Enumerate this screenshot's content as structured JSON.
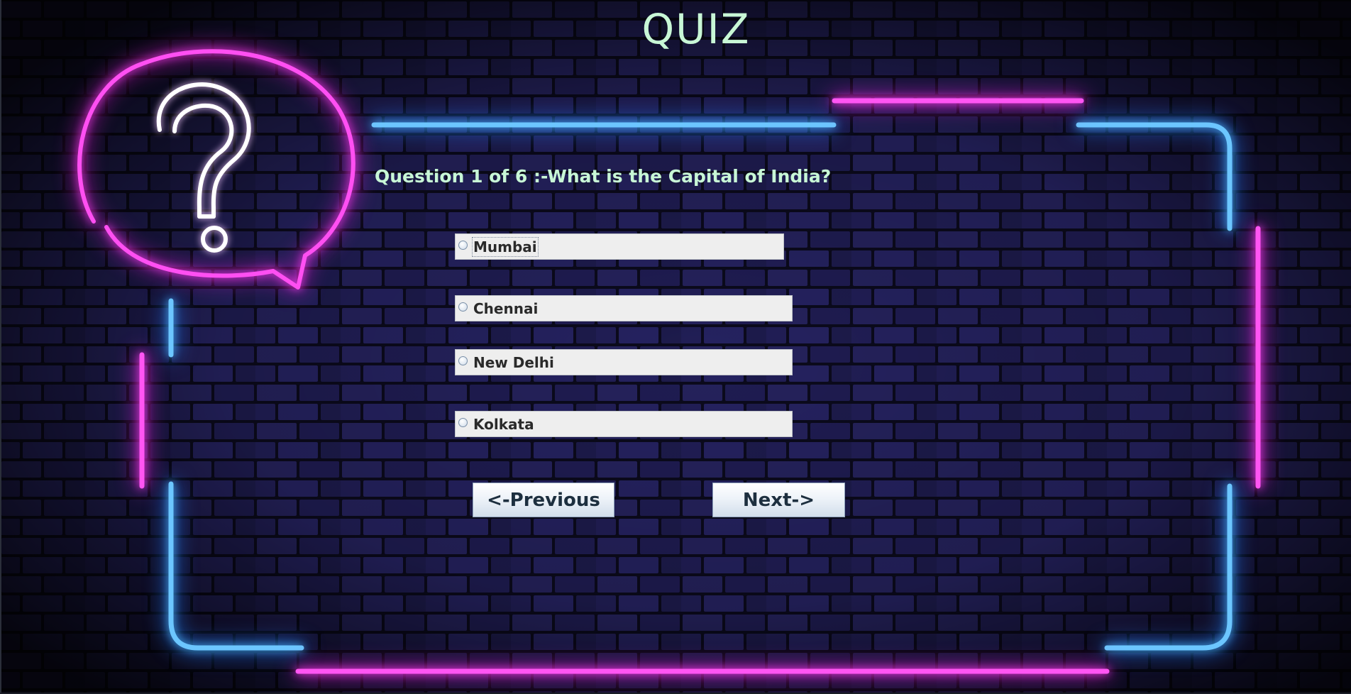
{
  "app": {
    "title": "QUIZ"
  },
  "question": {
    "text": "Question 1 of 6 :-What is the Capital of India?"
  },
  "options": [
    {
      "label": "Mumbai"
    },
    {
      "label": "Chennai"
    },
    {
      "label": "New Delhi"
    },
    {
      "label": "Kolkata"
    }
  ],
  "navigation": {
    "previous_label": "<-Previous",
    "next_label": "Next->"
  },
  "colors": {
    "title_text": "#c8f7d6",
    "neon_pink": "#ff3df2",
    "neon_blue": "#4fb8ff",
    "brick_wall": "#2c2870"
  }
}
